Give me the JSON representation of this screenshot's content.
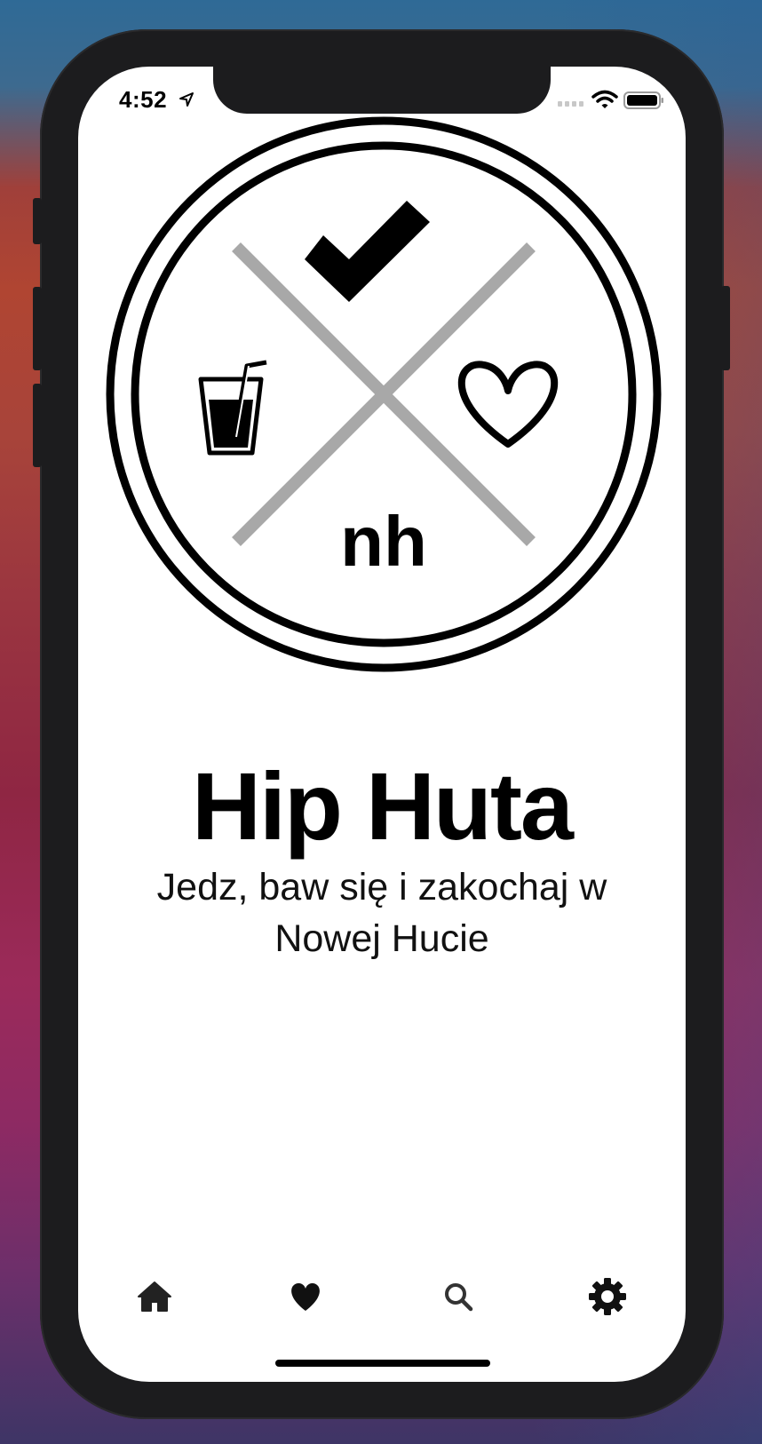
{
  "status_bar": {
    "time": "4:52",
    "location_icon": "location-arrow-icon",
    "signal_icon": "cellular-signal-icon",
    "wifi_icon": "wifi-icon",
    "battery_icon": "battery-full-icon"
  },
  "logo": {
    "monogram": "nh",
    "icons": [
      "checkmark-icon",
      "drink-icon",
      "heart-icon"
    ]
  },
  "app": {
    "title": "Hip Huta",
    "subtitle": "Jedz, baw się i zakochaj w Nowej Hucie"
  },
  "tabbar": {
    "items": [
      {
        "icon": "home-icon"
      },
      {
        "icon": "heart-icon"
      },
      {
        "icon": "search-icon"
      },
      {
        "icon": "gear-icon"
      }
    ]
  },
  "colors": {
    "frame": "#1c1c1e",
    "screen": "#ffffff",
    "cross": "#a8a8a8",
    "ink": "#000000"
  }
}
